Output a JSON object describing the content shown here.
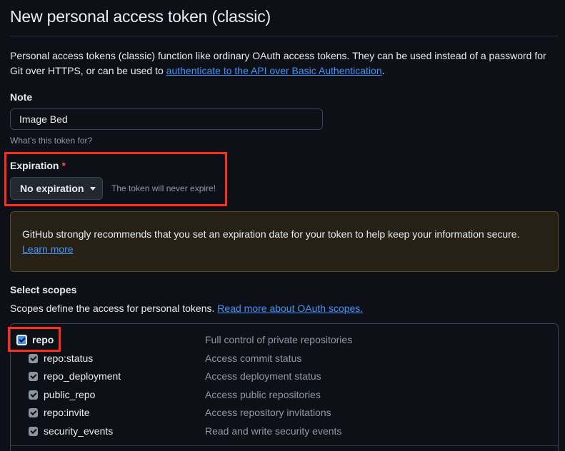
{
  "page": {
    "title": "New personal access token (classic)",
    "intro_text": "Personal access tokens (classic) function like ordinary OAuth access tokens. They can be used instead of a password for Git over HTTPS, or can be used to ",
    "intro_link": "authenticate to the API over Basic Authentication",
    "intro_end": "."
  },
  "note": {
    "label": "Note",
    "value": "Image Bed",
    "help": "What’s this token for?"
  },
  "expiration": {
    "label": "Expiration",
    "required_mark": "*",
    "selected": "No expiration",
    "note": "The token will never expire!"
  },
  "warning": {
    "text": "GitHub strongly recommends that you set an expiration date for your token to help keep your information secure.",
    "link": "Learn more"
  },
  "scopes": {
    "label": "Select scopes",
    "description": "Scopes define the access for personal tokens.",
    "link": "Read more about OAuth scopes.",
    "items": [
      {
        "name": "repo",
        "desc": "Full control of private repositories",
        "checked": true
      },
      {
        "name": "repo:status",
        "desc": "Access commit status",
        "checked": true
      },
      {
        "name": "repo_deployment",
        "desc": "Access deployment status",
        "checked": true
      },
      {
        "name": "public_repo",
        "desc": "Access public repositories",
        "checked": true
      },
      {
        "name": "repo:invite",
        "desc": "Access repository invitations",
        "checked": true
      },
      {
        "name": "security_events",
        "desc": "Read and write security events",
        "checked": true
      }
    ]
  },
  "colors": {
    "background": "#0d1117",
    "link": "#4493f8",
    "highlight": "#ff2d1a",
    "warning_bg": "#272115"
  }
}
